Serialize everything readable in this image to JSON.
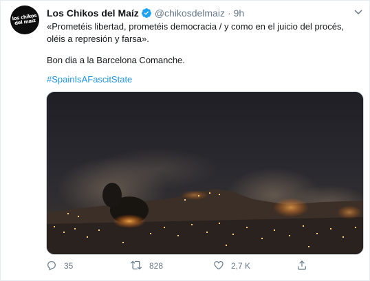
{
  "tweet": {
    "avatar_text": [
      "los chikos",
      "del maíz"
    ],
    "name": "Los Chikos del Maíz",
    "handle": "@chikosdelmaiz",
    "separator": "·",
    "time": "9h",
    "text_line1": "«Prometéis libertad, prometéis democracia / y como en el juicio del procés, oléis a represión y farsa».",
    "text_line2": "Bon dia a la Barcelona Comanche.",
    "hashtag": "#SpainIsAFascitState",
    "actions": {
      "replies": "35",
      "retweets": "828",
      "likes": "2,7 K"
    }
  },
  "colors": {
    "link": "#1b95e0",
    "secondary": "#657786",
    "verified": "#1da1f2"
  },
  "icons": [
    "verified-badge-icon",
    "chevron-down-icon",
    "reply-icon",
    "retweet-icon",
    "like-icon",
    "share-icon"
  ]
}
